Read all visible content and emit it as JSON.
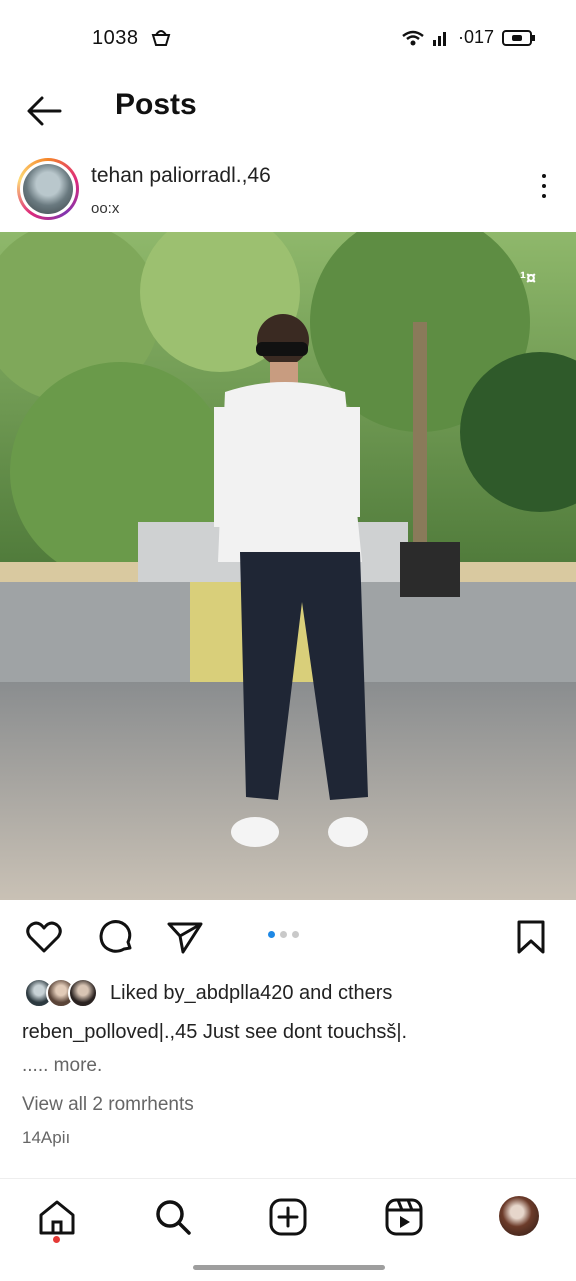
{
  "status": {
    "time": "1038",
    "right_text": "·017",
    "icons": [
      "notification-icon",
      "wifi-icon",
      "signal-icon",
      "battery-icon"
    ]
  },
  "header": {
    "title": "Posts",
    "back_icon": "arrow-left-icon"
  },
  "post": {
    "username": "tehan paliorradl.,46",
    "subline": "oo:x",
    "more_icon": "more-vertical-icon",
    "image_badge": "¹¤",
    "carousel": {
      "count": 3,
      "active_index": 0
    },
    "actions": [
      "heart-icon",
      "comment-icon",
      "send-icon",
      "bookmark-icon"
    ],
    "likes_text": "Liked by_abdplla420 and cthers",
    "caption": "reben_polloved|.,45 Just see dont touchsš|.",
    "more_label": "..... more.",
    "view_comments": "View all 2 romrhents",
    "date": "14Apiı"
  },
  "colors": {
    "accent": "#1e88e5",
    "notification_dot": "#e53935",
    "text": "#222222"
  },
  "bottom_nav": [
    "home-icon",
    "search-icon",
    "create-icon",
    "reels-icon",
    "profile-avatar"
  ]
}
